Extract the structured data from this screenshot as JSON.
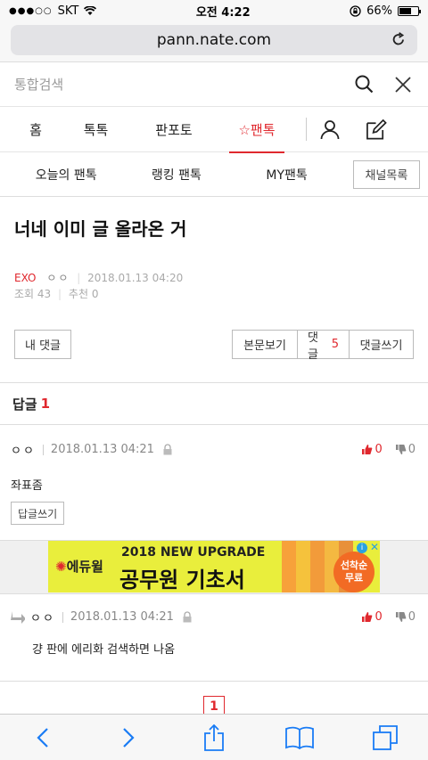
{
  "status_bar": {
    "carrier": "SKT",
    "time": "오전 4:22",
    "battery": "66%",
    "battery_level": 0.66
  },
  "browser": {
    "url": "pann.nate.com"
  },
  "search": {
    "placeholder": "통합검색"
  },
  "main_nav": {
    "items": [
      {
        "label": "홈"
      },
      {
        "label": "톡톡"
      },
      {
        "label": "판포토"
      },
      {
        "label": "☆팬톡",
        "active": true
      }
    ]
  },
  "sub_nav": {
    "items": [
      {
        "label": "오늘의 팬톡"
      },
      {
        "label": "랭킹 팬톡"
      },
      {
        "label": "MY팬톡"
      }
    ],
    "channel_button": "채널목록"
  },
  "post": {
    "title": "너네 이미 글 올라온 거",
    "channel": "EXO",
    "author": "ㅇㅇ",
    "date": "2018.01.13 04:20",
    "views_label": "조회",
    "views": "43",
    "recommend_label": "추천",
    "recommend": "0"
  },
  "buttons": {
    "my_comments": "내 댓글",
    "view_post": "본문보기",
    "comments_label": "댓글",
    "comments_count": "5",
    "write_comment": "댓글쓰기"
  },
  "comments_section": {
    "title": "답글",
    "count": "1"
  },
  "comment": {
    "author": "ㅇㅇ",
    "date": "2018.01.13 04:21",
    "up": "0",
    "down": "0",
    "body": "좌표좀",
    "reply_button": "답글쓰기"
  },
  "ad": {
    "brand": "에듀윌",
    "line1": "2018 NEW UPGRADE",
    "line2": "공무원 기초서",
    "badge_top": "선착순",
    "badge_bottom": "무료"
  },
  "reply": {
    "author": "ㅇㅇ",
    "date": "2018.01.13 04:21",
    "up": "0",
    "down": "0",
    "body": "걍 판에 에리화 검색하면 나옴"
  },
  "pagination": {
    "current": "1"
  },
  "colors": {
    "accent": "#e0282e"
  }
}
